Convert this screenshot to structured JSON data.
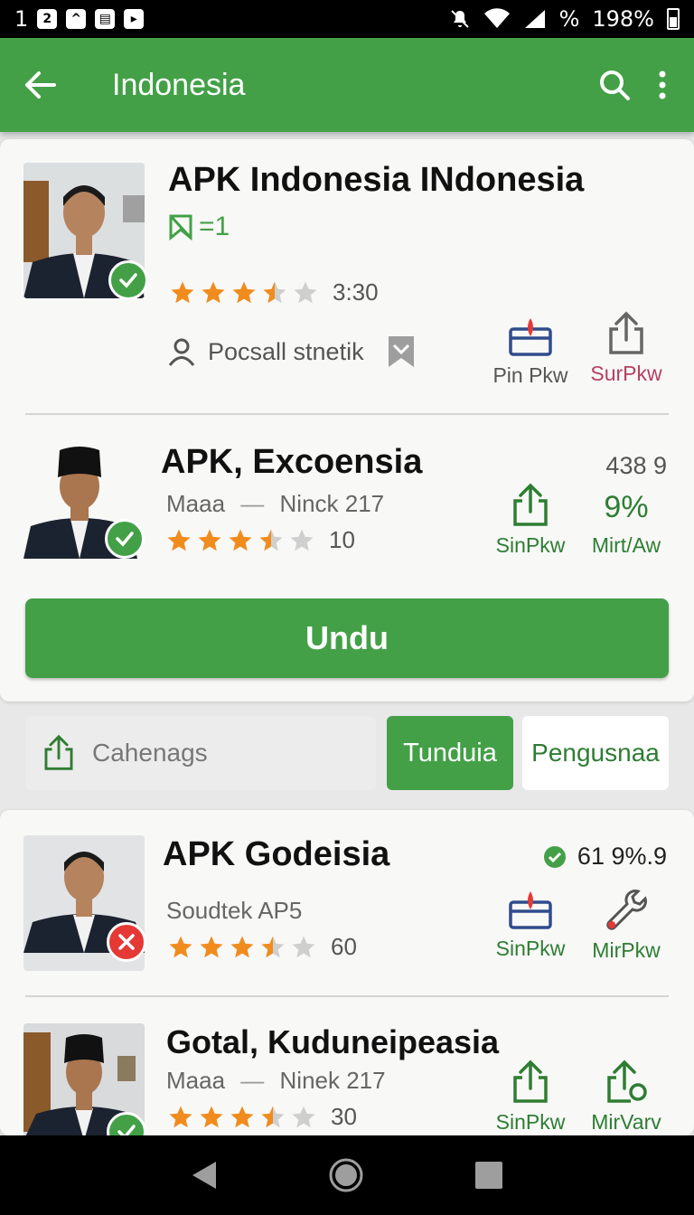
{
  "status_bar": {
    "left_number": "1",
    "icons": [
      "notification-icon",
      "alert-icon",
      "calendar-icon",
      "media-icon"
    ],
    "right_percent_sign": "%",
    "battery": "198%"
  },
  "app_bar": {
    "title": "Indonesia"
  },
  "items": [
    {
      "title": "APK Indonesia INdonesia",
      "tag": "=1",
      "rating_text": "3:30",
      "rating": 3.5,
      "author": "Pocsall stnetik",
      "badge": "ok",
      "actions": [
        {
          "label": "Pin Pkw",
          "icon": "install-icon",
          "color": "#555555"
        },
        {
          "label": "SurPkw",
          "icon": "share-icon",
          "color": "#b5405f"
        }
      ]
    },
    {
      "title": "APK, Excoensia",
      "sub_left": "Maaa",
      "sub_right": "Ninck 217",
      "rating_text": "10",
      "rating": 3.5,
      "count": "438 9",
      "badge": "ok",
      "actions": [
        {
          "label": "SinPkw",
          "icon": "share-icon",
          "color": "#2e7d32"
        },
        {
          "label": "Mirt/Aw",
          "value": "9%",
          "color": "#2e7d32"
        }
      ]
    },
    {
      "title": "APK Godeisia",
      "sub_left": "Soudtek AP5",
      "rating_text": "60",
      "rating": 3.5,
      "count": "61 9%.9",
      "badge": "err",
      "actions": [
        {
          "label": "SinPkw",
          "icon": "install-icon",
          "color": "#2e7d32"
        },
        {
          "label": "MirPkw",
          "icon": "wrench-icon",
          "color": "#2e7d32"
        }
      ]
    },
    {
      "title": "Gotal, Kuduneipeasia",
      "sub_left": "Maaa",
      "sub_right": "Ninek 217",
      "rating_text": "30",
      "rating": 3.5,
      "badge": "ok",
      "actions": [
        {
          "label": "SinPkw",
          "icon": "share-icon",
          "color": "#2e7d32"
        },
        {
          "label": "MirVarv",
          "icon": "share-settings-icon",
          "color": "#2e7d32"
        }
      ]
    }
  ],
  "download_button": "Undu",
  "filter_bar": {
    "input_text": "Cahenags",
    "active_tab": "Tunduia",
    "tab": "Pengusnaa"
  },
  "colors": {
    "brand_green": "#43a047",
    "star_orange": "#f08c1e",
    "error_red": "#e53935"
  }
}
